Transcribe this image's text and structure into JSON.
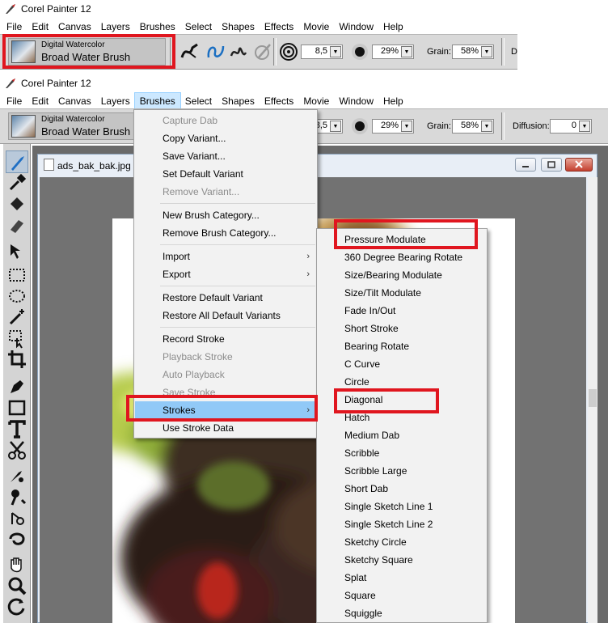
{
  "app_title": "Corel Painter 12",
  "menubar": [
    "File",
    "Edit",
    "Canvas",
    "Layers",
    "Brushes",
    "Select",
    "Shapes",
    "Effects",
    "Movie",
    "Window",
    "Help"
  ],
  "brush_selector": {
    "category": "Digital Watercolor",
    "variant": "Broad Water Brush"
  },
  "property_bar": {
    "size": "8,5",
    "opacity": "29%",
    "grain_label": "Grain:",
    "grain": "58%",
    "diffusion_label": "Diffusion:",
    "diffusion": "0"
  },
  "document": {
    "title": "ads_bak_bak.jpg @"
  },
  "brushes_menu": [
    {
      "label": "Capture Dab",
      "disabled": true
    },
    {
      "label": "Copy Variant...",
      "disabled": false
    },
    {
      "label": "Save Variant...",
      "disabled": false
    },
    {
      "label": "Set Default Variant",
      "disabled": false
    },
    {
      "label": "Remove Variant...",
      "disabled": true
    },
    {
      "label": "New Brush Category...",
      "disabled": false
    },
    {
      "label": "Remove Brush Category...",
      "disabled": false
    },
    {
      "label": "Import",
      "disabled": false,
      "submenu": true
    },
    {
      "label": "Export",
      "disabled": false,
      "submenu": true
    },
    {
      "label": "Restore Default Variant",
      "disabled": false
    },
    {
      "label": "Restore All Default Variants",
      "disabled": false
    },
    {
      "label": "Record Stroke",
      "disabled": false
    },
    {
      "label": "Playback Stroke",
      "disabled": true
    },
    {
      "label": "Auto Playback",
      "disabled": true
    },
    {
      "label": "Save Stroke",
      "disabled": true
    },
    {
      "label": "Strokes",
      "disabled": false,
      "submenu": true,
      "highlighted": true
    },
    {
      "label": "Use Stroke Data",
      "disabled": false
    }
  ],
  "strokes_submenu": [
    "Pressure Modulate",
    "360 Degree Bearing Rotate",
    "Size/Bearing Modulate",
    "Size/Tilt Modulate",
    "Fade In/Out",
    "Short Stroke",
    "Bearing Rotate",
    "C Curve",
    "Circle",
    "Diagonal",
    "Hatch",
    "Medium Dab",
    "Scribble",
    "Scribble Large",
    "Short Dab",
    "Single Sketch Line 1",
    "Single Sketch Line 2",
    "Sketchy Circle",
    "Sketchy Square",
    "Splat",
    "Square",
    "Squiggle"
  ],
  "colors": {
    "highlight_box": "#e0161f",
    "menu_selection": "#91c9f7",
    "menubar_active": "#cce8ff"
  }
}
